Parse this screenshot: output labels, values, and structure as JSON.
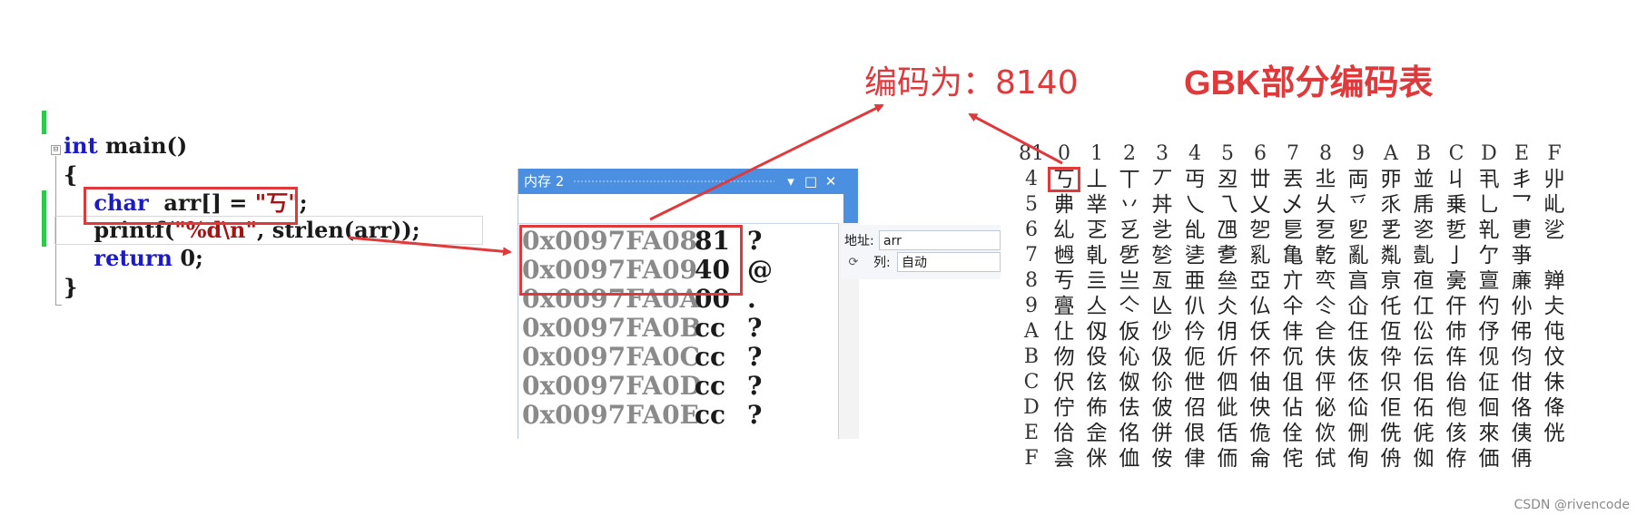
{
  "editor": {
    "lines": [
      {
        "parts": [
          {
            "t": "int",
            "c": "kw"
          },
          {
            "t": " main()",
            "c": ""
          }
        ]
      },
      {
        "parts": [
          {
            "t": "{",
            "c": ""
          }
        ]
      },
      {
        "parts": [
          {
            "t": "    ",
            "c": ""
          },
          {
            "t": "char",
            "c": "kw"
          },
          {
            "t": "  arr[] = ",
            "c": ""
          },
          {
            "t": "\"丂\"",
            "c": "str"
          },
          {
            "t": ";",
            "c": ""
          }
        ]
      },
      {
        "parts": [
          {
            "t": "    printf(",
            "c": ""
          },
          {
            "t": "\"%d\\n\"",
            "c": "str"
          },
          {
            "t": ", strlen(arr));",
            "c": ""
          }
        ]
      },
      {
        "parts": [
          {
            "t": "    ",
            "c": ""
          },
          {
            "t": "return",
            "c": "kw"
          },
          {
            "t": " 0;",
            "c": ""
          }
        ]
      },
      {
        "parts": [
          {
            "t": "}",
            "c": ""
          }
        ]
      }
    ],
    "fold_symbol": "⊟"
  },
  "annotation": {
    "encode_note": "编码为：8140",
    "gbk_title": "GBK部分编码表"
  },
  "memory_window": {
    "title": "内存 2",
    "buttons": [
      "▾",
      "□",
      "✕"
    ],
    "rows": [
      {
        "addr": "0x0097FA08",
        "val": "81",
        "chr": "?"
      },
      {
        "addr": "0x0097FA09",
        "val": "40",
        "chr": "@"
      },
      {
        "addr": "0x0097FA0A",
        "val": "00",
        "chr": "."
      },
      {
        "addr": "0x0097FA0B",
        "val": "cc",
        "chr": "?"
      },
      {
        "addr": "0x0097FA0C",
        "val": "cc",
        "chr": "?"
      },
      {
        "addr": "0x0097FA0D",
        "val": "cc",
        "chr": "?"
      },
      {
        "addr": "0x0097FA0E",
        "val": "cc",
        "chr": "?"
      }
    ]
  },
  "address_panel": {
    "address_label": "地址:",
    "address_value": "arr",
    "columns_label": "列:",
    "columns_value": "自动"
  },
  "gbk_table": {
    "corner": "81",
    "col_headers": [
      "0",
      "1",
      "2",
      "3",
      "4",
      "5",
      "6",
      "7",
      "8",
      "9",
      "A",
      "B",
      "C",
      "D",
      "E",
      "F"
    ],
    "rows": [
      {
        "h": "4",
        "cells": [
          "丂",
          "丄",
          "丅",
          "丆",
          "丏",
          "丒",
          "丗",
          "丟",
          "丠",
          "両",
          "丣",
          "並",
          "丩",
          "丮",
          "丯",
          "丱"
        ]
      },
      {
        "h": "5",
        "cells": [
          "丳",
          "丵",
          "丷",
          "丼",
          "乀",
          "乁",
          "乂",
          "乄",
          "乆",
          "乊",
          "乑",
          "乕",
          "乗",
          "乚",
          "乛",
          "乢"
        ]
      },
      {
        "h": "6",
        "cells": [
          "乣",
          "乤",
          "乥",
          "乧",
          "乨",
          "乪",
          "乫",
          "乬",
          "乭",
          "乮",
          "乯",
          "乲",
          "乴",
          "乵",
          "乶",
          "乷"
        ]
      },
      {
        "h": "7",
        "cells": [
          "乸",
          "乹",
          "乺",
          "乻",
          "乼",
          "乽",
          "乿",
          "亀",
          "亁",
          "亂",
          "亃",
          "亄",
          "亅",
          "亇",
          "亊",
          ""
        ]
      },
      {
        "h": "8",
        "cells": [
          "亐",
          "亖",
          "亗",
          "亙",
          "亜",
          "亝",
          "亞",
          "亣",
          "亪",
          "亯",
          "亰",
          "亱",
          "亴",
          "亶",
          "亷",
          "亸"
        ]
      },
      {
        "h": "9",
        "cells": [
          "亹",
          "亼",
          "亽",
          "亾",
          "仈",
          "仌",
          "仏",
          "仐",
          "仒",
          "仚",
          "仛",
          "仜",
          "仠",
          "仢",
          "仦",
          "仧"
        ]
      },
      {
        "h": "A",
        "cells": [
          "仩",
          "仭",
          "仮",
          "仯",
          "仱",
          "仴",
          "仸",
          "仹",
          "仺",
          "仼",
          "仾",
          "伀",
          "伂",
          "伃",
          "伄",
          "伅"
        ]
      },
      {
        "h": "B",
        "cells": [
          "伆",
          "伇",
          "伈",
          "伋",
          "伌",
          "伒",
          "伓",
          "伔",
          "伕",
          "伖",
          "伜",
          "伝",
          "伡",
          "伣",
          "伨",
          "伩"
        ]
      },
      {
        "h": "C",
        "cells": [
          "伬",
          "伭",
          "伮",
          "伱",
          "伳",
          "伵",
          "伷",
          "伹",
          "伻",
          "伾",
          "伿",
          "佀",
          "佁",
          "佂",
          "佄",
          "佅"
        ]
      },
      {
        "h": "D",
        "cells": [
          "佇",
          "佈",
          "佉",
          "佊",
          "佋",
          "佌",
          "佒",
          "佔",
          "佖",
          "佡",
          "佢",
          "佦",
          "佨",
          "佪",
          "佫",
          "佭"
        ]
      },
      {
        "h": "E",
        "cells": [
          "佮",
          "佱",
          "佲",
          "併",
          "佷",
          "佸",
          "佹",
          "佺",
          "佽",
          "侀",
          "侁",
          "侂",
          "侅",
          "來",
          "侇",
          "侊"
        ]
      },
      {
        "h": "F",
        "cells": [
          "侌",
          "侎",
          "侐",
          "侒",
          "侓",
          "侕",
          "侖",
          "侘",
          "侙",
          "侚",
          "侜",
          "侞",
          "侟",
          "価",
          "侢",
          ""
        ]
      }
    ]
  },
  "watermark": "CSDN @rivencode",
  "colors": {
    "accent_red": "#e0393b",
    "keyword_blue": "#1a1acc",
    "string_red": "#a31515",
    "titlebar_blue": "#4a8fe0",
    "change_green": "#2ec94a"
  }
}
